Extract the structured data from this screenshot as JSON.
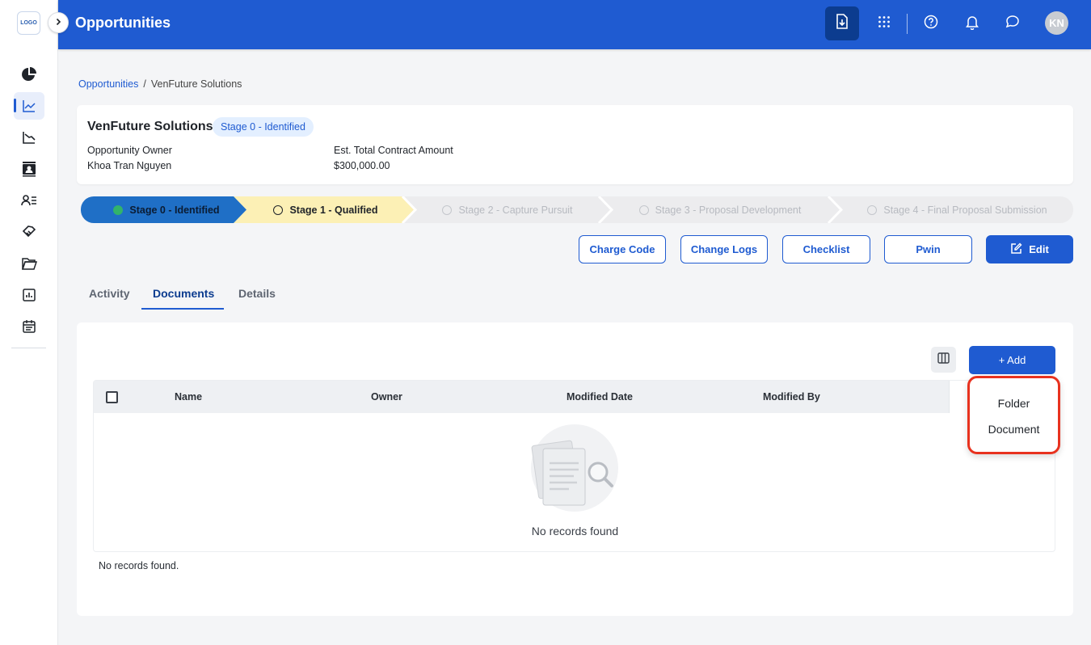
{
  "sidebar": {
    "logo_text": "LOGO",
    "items": [
      {
        "name": "dashboard",
        "icon": "pie-chart-icon"
      },
      {
        "name": "opportunities",
        "icon": "trend-line-icon",
        "active": true
      },
      {
        "name": "pipeline",
        "icon": "declining-chart-icon"
      },
      {
        "name": "contacts",
        "icon": "contact-card-icon"
      },
      {
        "name": "users",
        "icon": "user-list-icon"
      },
      {
        "name": "deals",
        "icon": "handshake-icon"
      },
      {
        "name": "folders",
        "icon": "folder-icon"
      },
      {
        "name": "reports",
        "icon": "bar-report-icon"
      },
      {
        "name": "calendar",
        "icon": "calendar-icon"
      }
    ]
  },
  "header": {
    "title": "Opportunities",
    "avatar_initials": "KN",
    "accent": "#1f5bd1"
  },
  "breadcrumb": {
    "parent": "Opportunities",
    "separator": "/",
    "current": "VenFuture Solutions"
  },
  "summary": {
    "name": "VenFuture Solutions",
    "stage_badge": "Stage 0 - Identified",
    "owner_label": "Opportunity Owner",
    "owner_value": "Khoa Tran Nguyen",
    "amount_label": "Est. Total Contract Amount",
    "amount_value": "$300,000.00"
  },
  "stepper": {
    "steps": [
      {
        "label": "Stage 0 - Identified",
        "state": "done"
      },
      {
        "label": "Stage 1 - Qualified",
        "state": "current"
      },
      {
        "label": "Stage 2 - Capture Pursuit",
        "state": "pending"
      },
      {
        "label": "Stage 3 - Proposal Development",
        "state": "pending"
      },
      {
        "label": "Stage 4 - Final Proposal Submission",
        "state": "pending"
      }
    ]
  },
  "actions": {
    "charge_code": "Charge Code",
    "change_logs": "Change Logs",
    "checklist": "Checklist",
    "pwin": "Pwin",
    "edit": "Edit"
  },
  "tabs": [
    {
      "label": "Activity"
    },
    {
      "label": "Documents",
      "active": true
    },
    {
      "label": "Details"
    }
  ],
  "documents": {
    "add_label": "+ Add",
    "columns": [
      "Name",
      "Owner",
      "Modified Date",
      "Modified By"
    ],
    "empty_text": "No records found",
    "footer_text": "No records found.",
    "dropdown": [
      "Folder",
      "Document"
    ]
  }
}
